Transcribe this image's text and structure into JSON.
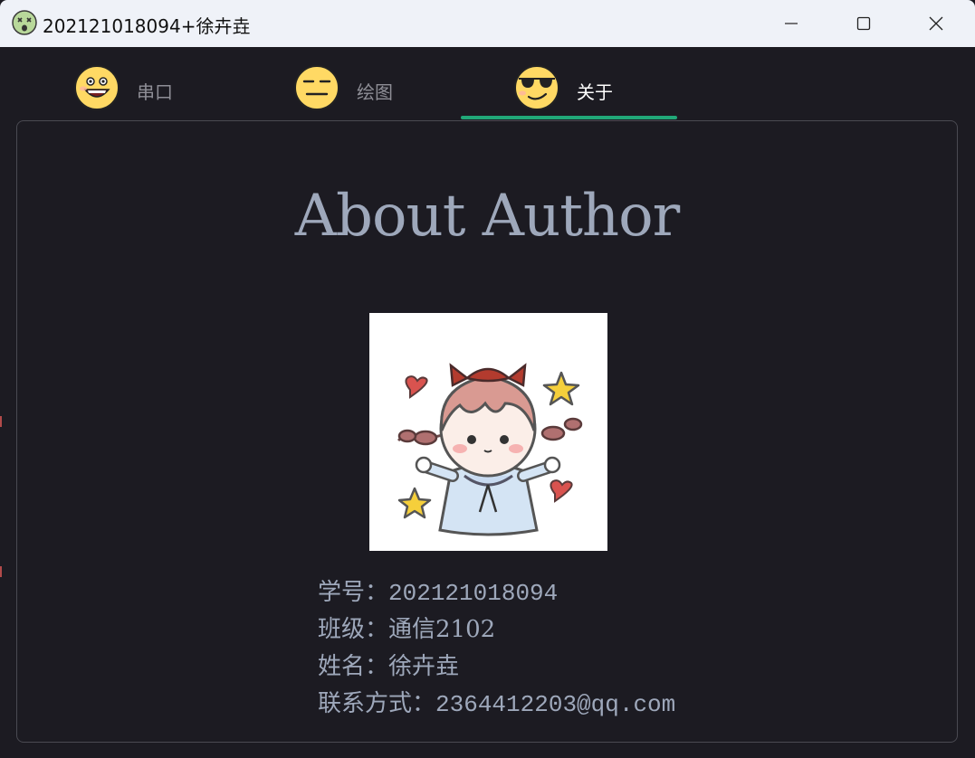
{
  "window": {
    "title": "202121018094+徐卉垚",
    "icon": "dizzy-face-icon"
  },
  "controls": {
    "minimize": "minimize-icon",
    "maximize": "maximize-icon",
    "close": "close-icon"
  },
  "tabs": [
    {
      "label": "串口",
      "icon": "grinning-face-icon",
      "active": false
    },
    {
      "label": "绘图",
      "icon": "expressionless-face-icon",
      "active": false
    },
    {
      "label": "关于",
      "icon": "sunglasses-face-icon",
      "active": true
    }
  ],
  "about": {
    "heading": "About Author",
    "avatar": "cartoon-girl-avatar",
    "student_id_label": "学号：",
    "student_id": "202121018094",
    "class_label": "班级：",
    "class": "通信2102",
    "name_label": "姓名：",
    "name": "徐卉垚",
    "contact_label": "联系方式：",
    "contact": "2364412203@qq.com"
  },
  "colors": {
    "background": "#1c1b22",
    "accent": "#21a878",
    "text": "#9ea8bb"
  }
}
